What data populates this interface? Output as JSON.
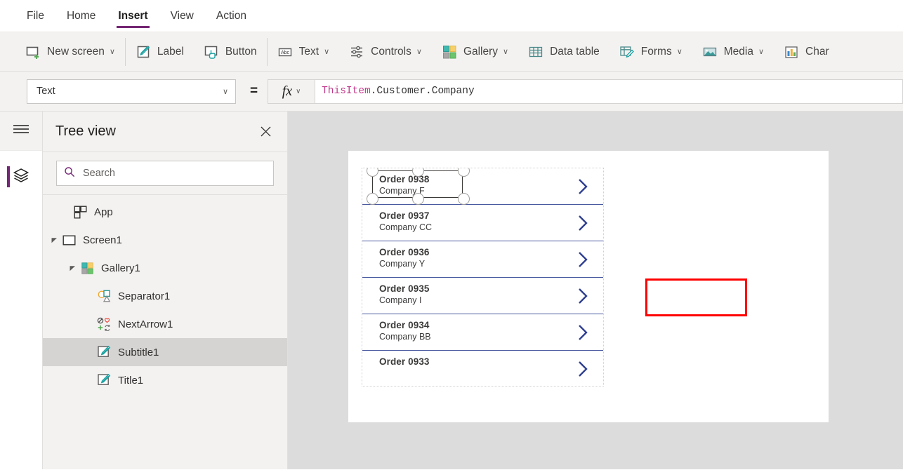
{
  "menubar": {
    "items": [
      {
        "label": "File",
        "active": false
      },
      {
        "label": "Home",
        "active": false
      },
      {
        "label": "Insert",
        "active": true
      },
      {
        "label": "View",
        "active": false
      },
      {
        "label": "Action",
        "active": false
      }
    ],
    "active_accent": "#742774"
  },
  "ribbon": {
    "items": [
      {
        "label": "New screen",
        "icon": "new-screen-icon",
        "caret": "∨"
      },
      {
        "label": "Label",
        "icon": "label-icon",
        "caret": ""
      },
      {
        "label": "Button",
        "icon": "button-icon",
        "caret": ""
      },
      {
        "label": "Text",
        "icon": "text-icon",
        "caret": "∨"
      },
      {
        "label": "Controls",
        "icon": "controls-icon",
        "caret": "∨"
      },
      {
        "label": "Gallery",
        "icon": "gallery-icon",
        "caret": "∨"
      },
      {
        "label": "Data table",
        "icon": "data-table-icon",
        "caret": ""
      },
      {
        "label": "Forms",
        "icon": "forms-icon",
        "caret": "∨"
      },
      {
        "label": "Media",
        "icon": "media-icon",
        "caret": "∨"
      },
      {
        "label": "Char",
        "icon": "charts-icon",
        "caret": ""
      }
    ]
  },
  "formula_bar": {
    "property": "Text",
    "property_caret": "∨",
    "equals": "=",
    "fx_glyph": "fx",
    "fx_caret": "∨",
    "formula_object": "ThisItem",
    "formula_rest": ".Customer.Company",
    "formula_full": "ThisItem.Customer.Company",
    "object_color": "#c0398a"
  },
  "rail": {
    "hamburger": "hamburger-icon",
    "items": [
      {
        "name": "tree-view",
        "icon": "layers-icon",
        "active": true
      }
    ]
  },
  "tree_panel": {
    "title": "Tree view",
    "close": "✕",
    "search_placeholder": "Search",
    "search_value": "",
    "nodes": [
      {
        "label": "App",
        "indent": 0,
        "twisty": "none",
        "icon": "app-icon",
        "selected": false
      },
      {
        "label": "Screen1",
        "indent": 0,
        "twisty": "expanded",
        "icon": "screen-icon",
        "selected": false
      },
      {
        "label": "Gallery1",
        "indent": 1,
        "twisty": "expanded",
        "icon": "gallery-icon",
        "selected": false
      },
      {
        "label": "Separator1",
        "indent": 2,
        "twisty": "none",
        "icon": "shapes-icon",
        "selected": false
      },
      {
        "label": "NextArrow1",
        "indent": 2,
        "twisty": "none",
        "icon": "icons-icon",
        "selected": false
      },
      {
        "label": "Subtitle1",
        "indent": 2,
        "twisty": "none",
        "icon": "label-icon",
        "selected": true
      },
      {
        "label": "Title1",
        "indent": 2,
        "twisty": "none",
        "icon": "label-icon",
        "selected": false
      }
    ]
  },
  "canvas": {
    "background": "#dcdcdc",
    "screen_background": "#ffffff",
    "separator_color": "#4a5aa0",
    "chevron_color": "#2f3f91",
    "selection_highlight_color": "#ff0000",
    "gallery_rows": [
      {
        "title": "Order 0938",
        "subtitle": "Company F",
        "selected": true,
        "clipped": false
      },
      {
        "title": "Order 0937",
        "subtitle": "Company CC",
        "selected": false,
        "clipped": false
      },
      {
        "title": "Order 0936",
        "subtitle": "Company Y",
        "selected": false,
        "clipped": false
      },
      {
        "title": "Order 0935",
        "subtitle": "Company I",
        "selected": false,
        "clipped": false
      },
      {
        "title": "Order 0934",
        "subtitle": "Company BB",
        "selected": false,
        "clipped": false
      },
      {
        "title": "Order 0933",
        "subtitle": "",
        "selected": false,
        "clipped": true
      }
    ]
  }
}
